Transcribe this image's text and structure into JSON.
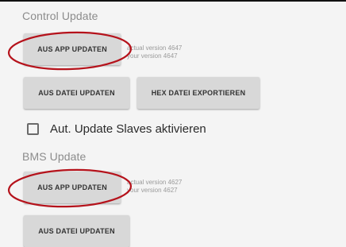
{
  "control_update": {
    "title": "Control Update",
    "btn_app": "AUS APP UPDATEN",
    "actual_version": "actual version 4647",
    "your_version": "your version 4647",
    "btn_file": "AUS DATEI UPDATEN",
    "btn_hex": "HEX DATEI EXPORTIEREN"
  },
  "slaves": {
    "checkbox_label": "Aut. Update Slaves aktivieren",
    "checked": false
  },
  "bms_update": {
    "title": "BMS Update",
    "btn_app": "AUS APP UPDATEN",
    "actual_version": "actual version 4627",
    "your_version": "your version 4627",
    "btn_file": "AUS DATEI UPDATEN"
  },
  "colors": {
    "background": "#f4f4f4",
    "button": "#d8d8d8",
    "annotation": "#b5121b"
  }
}
